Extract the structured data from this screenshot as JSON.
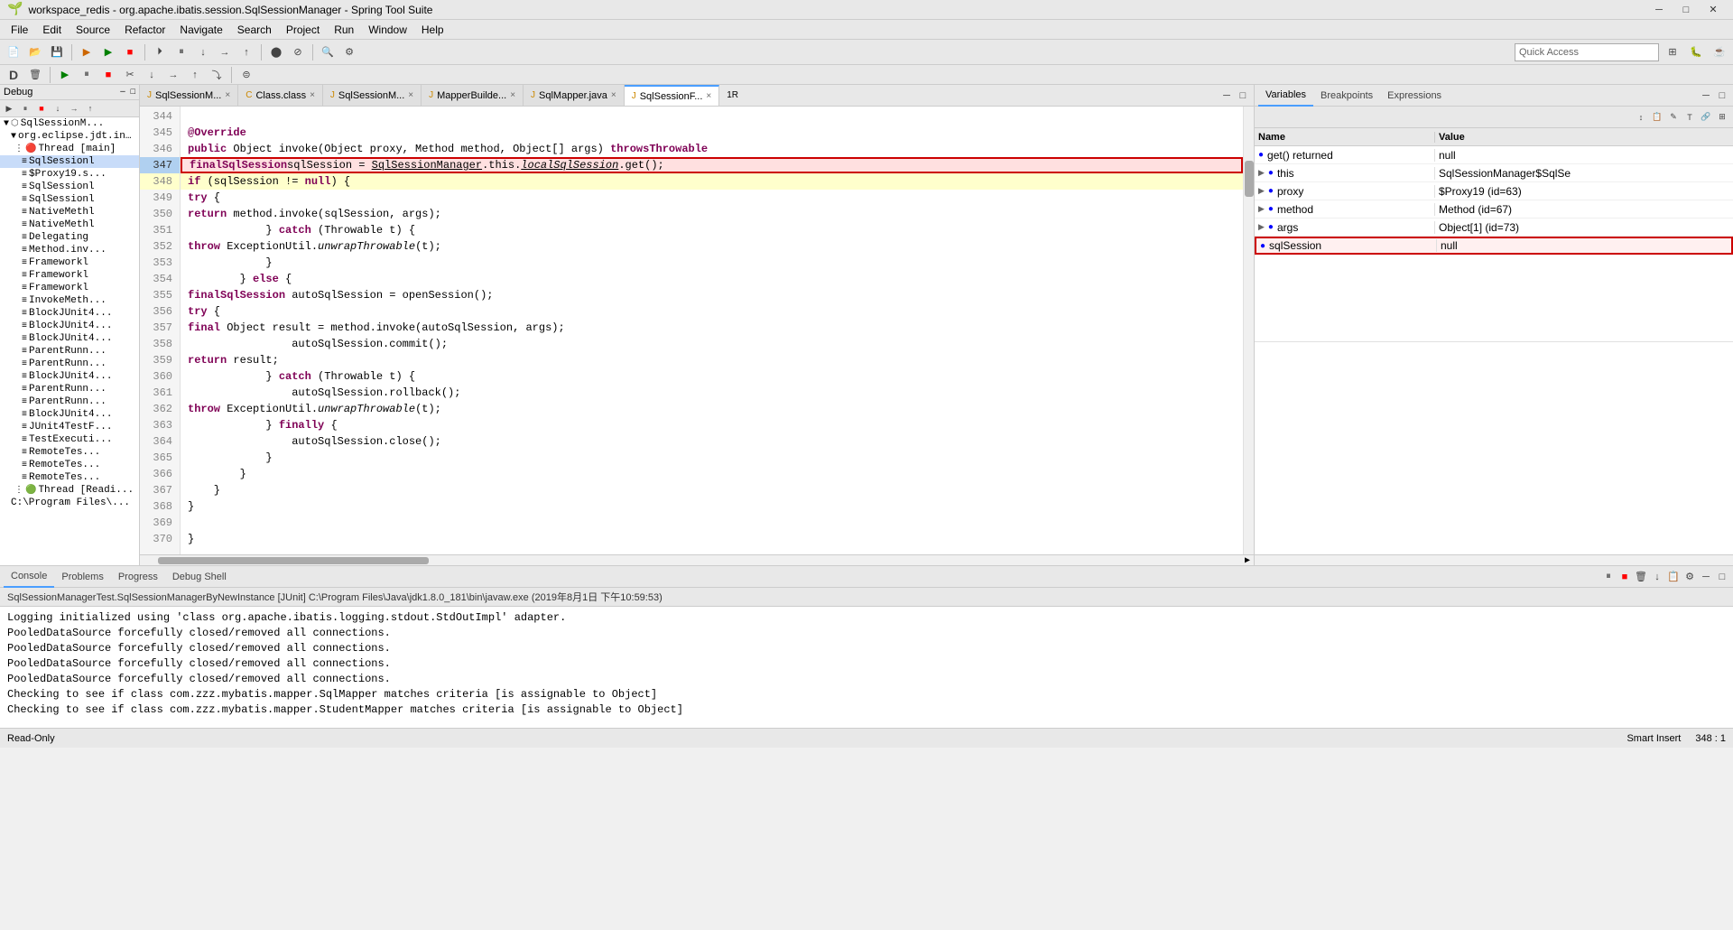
{
  "window": {
    "title": "workspace_redis - org.apache.ibatis.session.SqlSessionManager - Spring Tool Suite"
  },
  "menu": {
    "items": [
      "File",
      "Edit",
      "Source",
      "Refactor",
      "Navigate",
      "Search",
      "Project",
      "Run",
      "Window",
      "Help"
    ]
  },
  "toolbar": {
    "quick_access_placeholder": "Quick Access"
  },
  "editor": {
    "tabs": [
      {
        "label": "SqlSessionM...",
        "active": false,
        "icon": "J"
      },
      {
        "label": "Class.class",
        "active": false,
        "icon": "C"
      },
      {
        "label": "SqlSessionM...",
        "active": false,
        "icon": "J"
      },
      {
        "label": "MapperBuilde...",
        "active": false,
        "icon": "J"
      },
      {
        "label": "SqlMapper.java",
        "active": false,
        "icon": "J"
      },
      {
        "label": "SqlSessionF...",
        "active": true,
        "icon": "J"
      }
    ],
    "lines": [
      {
        "num": 344,
        "content": ""
      },
      {
        "num": 345,
        "content": "    @Override"
      },
      {
        "num": 346,
        "content": "    public Object invoke(Object proxy, Method method, Object[] args) throws Throwable"
      },
      {
        "num": 347,
        "content": "        final SqlSession sqlSession = SqlSessionManager.this.localSqlSession.get();"
      },
      {
        "num": 348,
        "content": "        if (sqlSession != null) {"
      },
      {
        "num": 349,
        "content": "            try {"
      },
      {
        "num": 350,
        "content": "                return method.invoke(sqlSession, args);"
      },
      {
        "num": 351,
        "content": "            } catch (Throwable t) {"
      },
      {
        "num": 352,
        "content": "                throw ExceptionUtil.unwrapThrowable(t);"
      },
      {
        "num": 353,
        "content": "            }"
      },
      {
        "num": 354,
        "content": "        } else {"
      },
      {
        "num": 355,
        "content": "            final SqlSession autoSqlSession = openSession();"
      },
      {
        "num": 356,
        "content": "            try {"
      },
      {
        "num": 357,
        "content": "                final Object result = method.invoke(autoSqlSession, args);"
      },
      {
        "num": 358,
        "content": "                autoSqlSession.commit();"
      },
      {
        "num": 359,
        "content": "                return result;"
      },
      {
        "num": 360,
        "content": "            } catch (Throwable t) {"
      },
      {
        "num": 361,
        "content": "                autoSqlSession.rollback();"
      },
      {
        "num": 362,
        "content": "                throw ExceptionUtil.unwrapThrowable(t);"
      },
      {
        "num": 363,
        "content": "            } finally {"
      },
      {
        "num": 364,
        "content": "                autoSqlSession.close();"
      },
      {
        "num": 365,
        "content": "            }"
      },
      {
        "num": 366,
        "content": "        }"
      },
      {
        "num": 367,
        "content": "    }"
      },
      {
        "num": 368,
        "content": "}"
      },
      {
        "num": 369,
        "content": ""
      },
      {
        "num": 370,
        "content": "}"
      }
    ]
  },
  "sidebar": {
    "title": "Debug",
    "items": [
      {
        "label": "SqlSessionM...",
        "level": 0,
        "type": "thread",
        "selected": true
      },
      {
        "label": "org.eclipse.jdt.in...",
        "level": 1,
        "type": "package"
      },
      {
        "label": "Thread [main]",
        "level": 2,
        "type": "thread"
      },
      {
        "label": "SqlSessionl",
        "level": 3,
        "type": "frame"
      },
      {
        "label": "$Proxy19.s...",
        "level": 3,
        "type": "frame"
      },
      {
        "label": "SqlSessionl",
        "level": 3,
        "type": "frame"
      },
      {
        "label": "SqlSessionl",
        "level": 3,
        "type": "frame"
      },
      {
        "label": "NativeMethl",
        "level": 3,
        "type": "frame"
      },
      {
        "label": "NativeMethl",
        "level": 3,
        "type": "frame"
      },
      {
        "label": "Delegating",
        "level": 3,
        "type": "frame"
      },
      {
        "label": "Method.inv...",
        "level": 3,
        "type": "frame"
      },
      {
        "label": "Frameworkl",
        "level": 3,
        "type": "frame"
      },
      {
        "label": "Frameworkl",
        "level": 3,
        "type": "frame"
      },
      {
        "label": "Frameworkl",
        "level": 3,
        "type": "frame"
      },
      {
        "label": "InvokeMeth...",
        "level": 3,
        "type": "frame"
      },
      {
        "label": "BlockJUnit4...",
        "level": 3,
        "type": "frame"
      },
      {
        "label": "BlockJUnit4...",
        "level": 3,
        "type": "frame"
      },
      {
        "label": "BlockJUnit4...",
        "level": 3,
        "type": "frame"
      },
      {
        "label": "ParentRunn...",
        "level": 3,
        "type": "frame"
      },
      {
        "label": "ParentRunn...",
        "level": 3,
        "type": "frame"
      },
      {
        "label": "BlockJUnit4...",
        "level": 3,
        "type": "frame"
      },
      {
        "label": "ParentRunn...",
        "level": 3,
        "type": "frame"
      },
      {
        "label": "ParentRunn...",
        "level": 3,
        "type": "frame"
      },
      {
        "label": "BlockJUnit4...",
        "level": 3,
        "type": "frame"
      },
      {
        "label": "JUnit4TestF...",
        "level": 3,
        "type": "frame"
      },
      {
        "label": "TestExecuti...",
        "level": 3,
        "type": "frame"
      },
      {
        "label": "RemoteTes...",
        "level": 3,
        "type": "frame"
      },
      {
        "label": "RemoteTes...",
        "level": 3,
        "type": "frame"
      },
      {
        "label": "RemoteTes...",
        "level": 3,
        "type": "frame"
      },
      {
        "label": "Thread [Readi...",
        "level": 2,
        "type": "thread"
      },
      {
        "label": "C:\\Program Files\\...",
        "level": 1,
        "type": "program"
      }
    ]
  },
  "variables": {
    "panel_title": "Variables",
    "tabs": [
      "Variables",
      "Breakpoints",
      "Expressions"
    ],
    "columns": {
      "name": "Name",
      "value": "Value"
    },
    "rows": [
      {
        "name": "get() returned",
        "value": "null",
        "indent": 0,
        "expandable": false
      },
      {
        "name": "this",
        "value": "SqlSessionManager$SqlSe",
        "indent": 0,
        "expandable": true
      },
      {
        "name": "proxy",
        "value": "$Proxy19 (id=63)",
        "indent": 0,
        "expandable": true
      },
      {
        "name": "method",
        "value": "Method (id=67)",
        "indent": 0,
        "expandable": true
      },
      {
        "name": "args",
        "value": "Object[1] (id=73)",
        "indent": 0,
        "expandable": true
      },
      {
        "name": "sqlSession",
        "value": "null",
        "indent": 0,
        "expandable": false,
        "selected": true
      }
    ]
  },
  "console": {
    "tabs": [
      "Console",
      "Problems",
      "Progress",
      "Debug Shell"
    ],
    "header": "SqlSessionManagerTest.SqlSessionManagerByNewInstance [JUnit] C:\\Program Files\\Java\\jdk1.8.0_181\\bin\\javaw.exe (2019年8月1日 下午10:59:53)",
    "output": [
      "Logging initialized using 'class org.apache.ibatis.logging.stdout.StdOutImpl' adapter.",
      "PooledDataSource forcefully closed/removed all connections.",
      "PooledDataSource forcefully closed/removed all connections.",
      "PooledDataSource forcefully closed/removed all connections.",
      "PooledDataSource forcefully closed/removed all connections.",
      "Checking to see if class com.zzz.mybatis.mapper.SqlMapper matches criteria [is assignable to Object]",
      "Checking to see if class com.zzz.mybatis.mapper.StudentMapper matches criteria [is assignable to Object]"
    ]
  },
  "status_bar": {
    "mode": "Read-Only",
    "insert": "Smart Insert",
    "position": "348 : 1"
  }
}
